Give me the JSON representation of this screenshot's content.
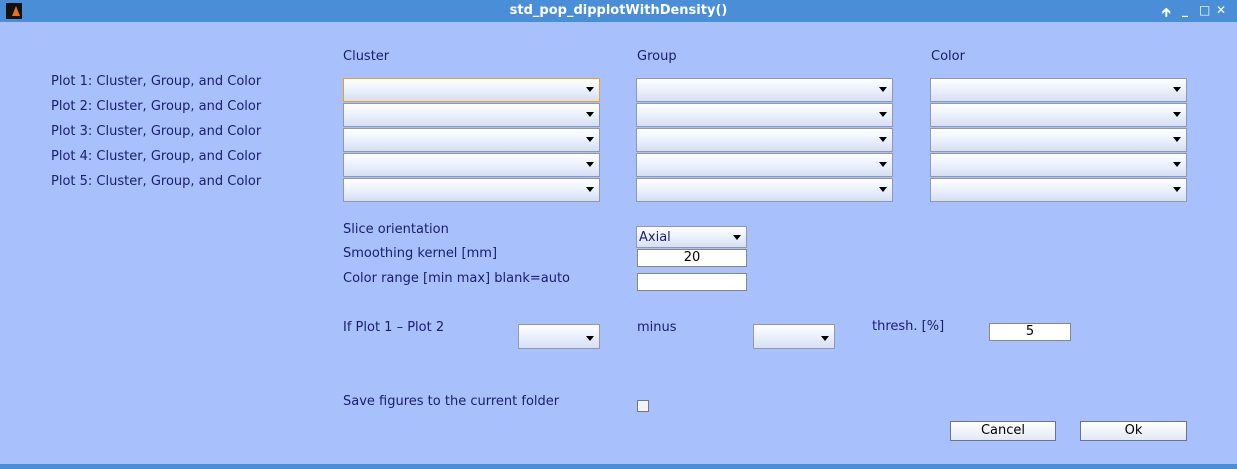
{
  "window": {
    "title": "std_pop_dipplotWithDensity()",
    "controls": [
      "pin-icon",
      "minimize-icon",
      "maximize-icon",
      "close-icon"
    ]
  },
  "columns": {
    "cluster": "Cluster",
    "group": "Group",
    "color": "Color"
  },
  "rows": [
    {
      "label": "Plot 1: Cluster, Group, and Color"
    },
    {
      "label": "Plot 2: Cluster, Group, and Color"
    },
    {
      "label": "Plot 3: Cluster, Group, and Color"
    },
    {
      "label": "Plot 4: Cluster, Group, and Color"
    },
    {
      "label": "Plot 5: Cluster, Group, and Color"
    }
  ],
  "slice": {
    "label": "Slice orientation",
    "value": "Axial"
  },
  "smoothing": {
    "label": "Smoothing kernel [mm]",
    "value": "20"
  },
  "color_range": {
    "label": "Color range [min max] blank=auto",
    "value": ""
  },
  "diff": {
    "label": "If Plot 1 – Plot 2",
    "minus": "minus",
    "thresh_label": "thresh. [%]",
    "thresh_value": "5"
  },
  "save": {
    "label": "Save figures to the current folder",
    "checked": false
  },
  "buttons": {
    "cancel": "Cancel",
    "ok": "Ok"
  }
}
